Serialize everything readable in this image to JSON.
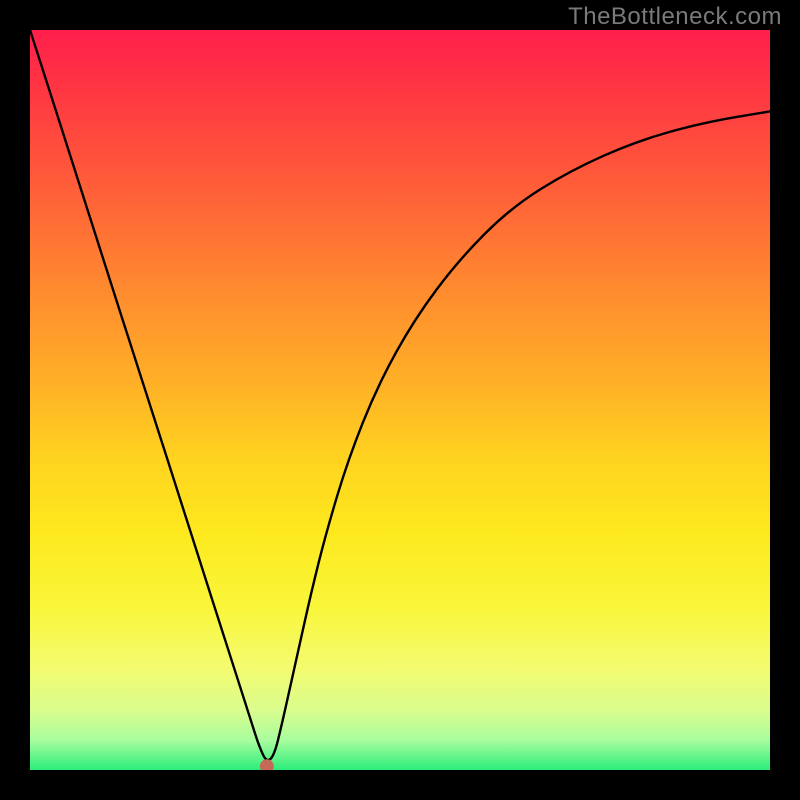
{
  "watermark": "TheBottleneck.com",
  "chart_data": {
    "type": "line",
    "title": "",
    "xlabel": "",
    "ylabel": "",
    "xlim": [
      0,
      1
    ],
    "ylim": [
      0,
      1
    ],
    "series": [
      {
        "name": "bottleneck-curve",
        "x": [
          0.0,
          0.02,
          0.05,
          0.08,
          0.11,
          0.14,
          0.17,
          0.2,
          0.23,
          0.26,
          0.28,
          0.3,
          0.31,
          0.32,
          0.33,
          0.34,
          0.36,
          0.38,
          0.4,
          0.43,
          0.47,
          0.52,
          0.58,
          0.65,
          0.73,
          0.82,
          0.91,
          1.0
        ],
        "y": [
          1.0,
          0.938,
          0.844,
          0.75,
          0.656,
          0.562,
          0.469,
          0.375,
          0.281,
          0.187,
          0.125,
          0.062,
          0.031,
          0.01,
          0.02,
          0.06,
          0.15,
          0.24,
          0.32,
          0.42,
          0.52,
          0.61,
          0.69,
          0.76,
          0.81,
          0.85,
          0.875,
          0.89
        ]
      }
    ],
    "marker": {
      "x": 0.32,
      "y": 0.005
    },
    "gradient_stops": [
      {
        "pos": 0.0,
        "color": "#ff1e4c"
      },
      {
        "pos": 0.06,
        "color": "#ff3044"
      },
      {
        "pos": 0.2,
        "color": "#ff5a3a"
      },
      {
        "pos": 0.35,
        "color": "#ff8a2f"
      },
      {
        "pos": 0.48,
        "color": "#ffb127"
      },
      {
        "pos": 0.58,
        "color": "#ffd31f"
      },
      {
        "pos": 0.68,
        "color": "#fde91e"
      },
      {
        "pos": 0.78,
        "color": "#f9f63a"
      },
      {
        "pos": 0.86,
        "color": "#f4fb6e"
      },
      {
        "pos": 0.92,
        "color": "#d9fd8e"
      },
      {
        "pos": 0.96,
        "color": "#a8fd9e"
      },
      {
        "pos": 1.0,
        "color": "#2bee7a"
      }
    ]
  }
}
